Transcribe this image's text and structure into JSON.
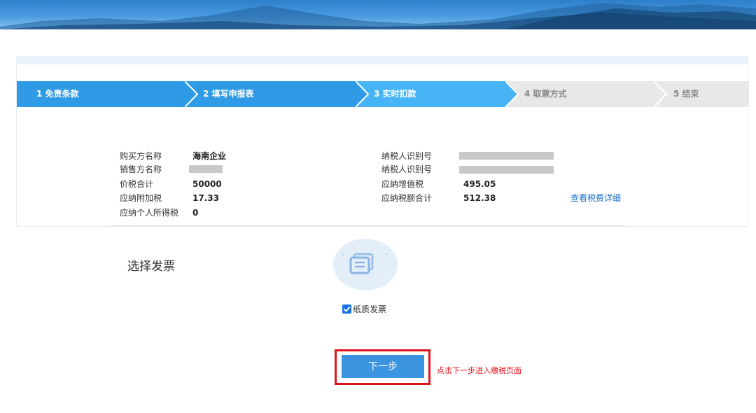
{
  "steps": [
    {
      "label": "1 免责条款",
      "state": "active"
    },
    {
      "label": "2 填写申报表",
      "state": "active"
    },
    {
      "label": "3 实时扣款",
      "state": "current"
    },
    {
      "label": "4 取票方式",
      "state": "inactive"
    },
    {
      "label": "5 结束",
      "state": "inactive"
    }
  ],
  "info": {
    "buyer_name_label": "购买方名称",
    "buyer_name_value": "海南企业",
    "seller_name_label": "销售方名称",
    "price_tax_total_label": "价税合计",
    "price_tax_total_value": "50000",
    "surcharge_label": "应纳附加税",
    "surcharge_value": "17.33",
    "personal_income_tax_label": "应纳个人所得税",
    "personal_income_tax_value": "0",
    "taxpayer_id_label_1": "纳税人识别号",
    "taxpayer_id_label_2": "纳税人识别号",
    "vat_label": "应纳增值税",
    "vat_value": "495.05",
    "tax_total_label": "应纳税额合计",
    "tax_total_value": "512.38",
    "detail_link": "查看税费详细"
  },
  "invoice": {
    "section_label": "选择发票",
    "paper_invoice_label": "纸质发票",
    "paper_invoice_checked": true
  },
  "actions": {
    "next_label": "下一步",
    "hint": "点击下一步进入缴税页面"
  },
  "colors": {
    "step_active": "#2f9be6",
    "step_current": "#47b4f5",
    "step_inactive": "#e8e8e8",
    "link": "#1a6fc9",
    "highlight": "#e0121a",
    "button": "#3a94e0"
  }
}
